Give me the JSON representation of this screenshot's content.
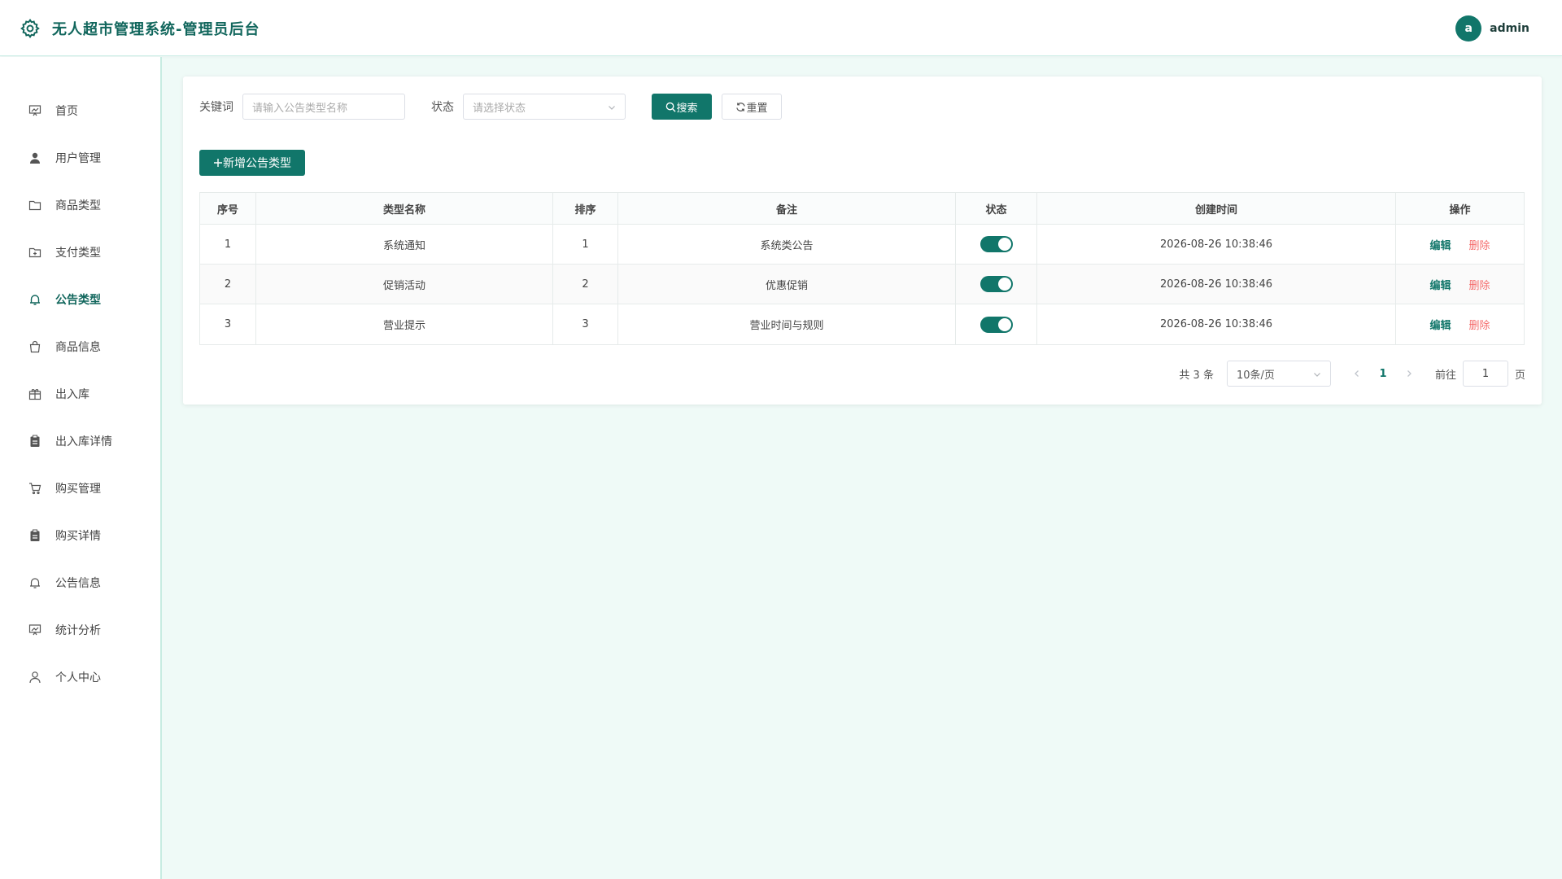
{
  "app": {
    "title": "无人超市管理系统-管理员后台"
  },
  "user": {
    "avatar_letter": "a",
    "name": "admin"
  },
  "sidebar": {
    "items": [
      {
        "label": "首页",
        "icon": "monitor-chart-icon"
      },
      {
        "label": "用户管理",
        "icon": "user-filled-icon"
      },
      {
        "label": "商品类型",
        "icon": "folder-icon"
      },
      {
        "label": "支付类型",
        "icon": "folder-add-icon"
      },
      {
        "label": "公告类型",
        "icon": "bell-icon",
        "active": true
      },
      {
        "label": "商品信息",
        "icon": "shopping-bag-icon"
      },
      {
        "label": "出入库",
        "icon": "gift-box-icon"
      },
      {
        "label": "出入库详情",
        "icon": "clipboard-icon"
      },
      {
        "label": "购买管理",
        "icon": "shopping-cart-icon"
      },
      {
        "label": "购买详情",
        "icon": "clipboard-icon"
      },
      {
        "label": "公告信息",
        "icon": "bell-icon"
      },
      {
        "label": "统计分析",
        "icon": "monitor-chart-icon"
      },
      {
        "label": "个人中心",
        "icon": "user-icon"
      }
    ]
  },
  "search": {
    "keyword_label": "关键词",
    "keyword_placeholder": "请输入公告类型名称",
    "status_label": "状态",
    "status_placeholder": "请选择状态",
    "search_button": "搜索",
    "reset_button": "重置"
  },
  "toolbar": {
    "add_button": "新增公告类型"
  },
  "table": {
    "headers": [
      "序号",
      "类型名称",
      "排序",
      "备注",
      "状态",
      "创建时间",
      "操作"
    ],
    "rows": [
      {
        "index": "1",
        "name": "系统通知",
        "sort": "1",
        "remark": "系统类公告",
        "status": true,
        "created": "2026-08-26 10:38:46"
      },
      {
        "index": "2",
        "name": "促销活动",
        "sort": "2",
        "remark": "优惠促销",
        "status": true,
        "created": "2026-08-26 10:38:46"
      },
      {
        "index": "3",
        "name": "营业提示",
        "sort": "3",
        "remark": "营业时间与规则",
        "status": true,
        "created": "2026-08-26 10:38:46"
      }
    ],
    "edit_label": "编辑",
    "delete_label": "删除"
  },
  "pagination": {
    "total_text": "共 3 条",
    "page_size": "10条/页",
    "current_page": "1",
    "goto_label": "前往",
    "goto_value": "1",
    "page_suffix": "页"
  },
  "colors": {
    "primary": "#11766a",
    "danger": "#f56c6c",
    "background": "#effaf7"
  }
}
